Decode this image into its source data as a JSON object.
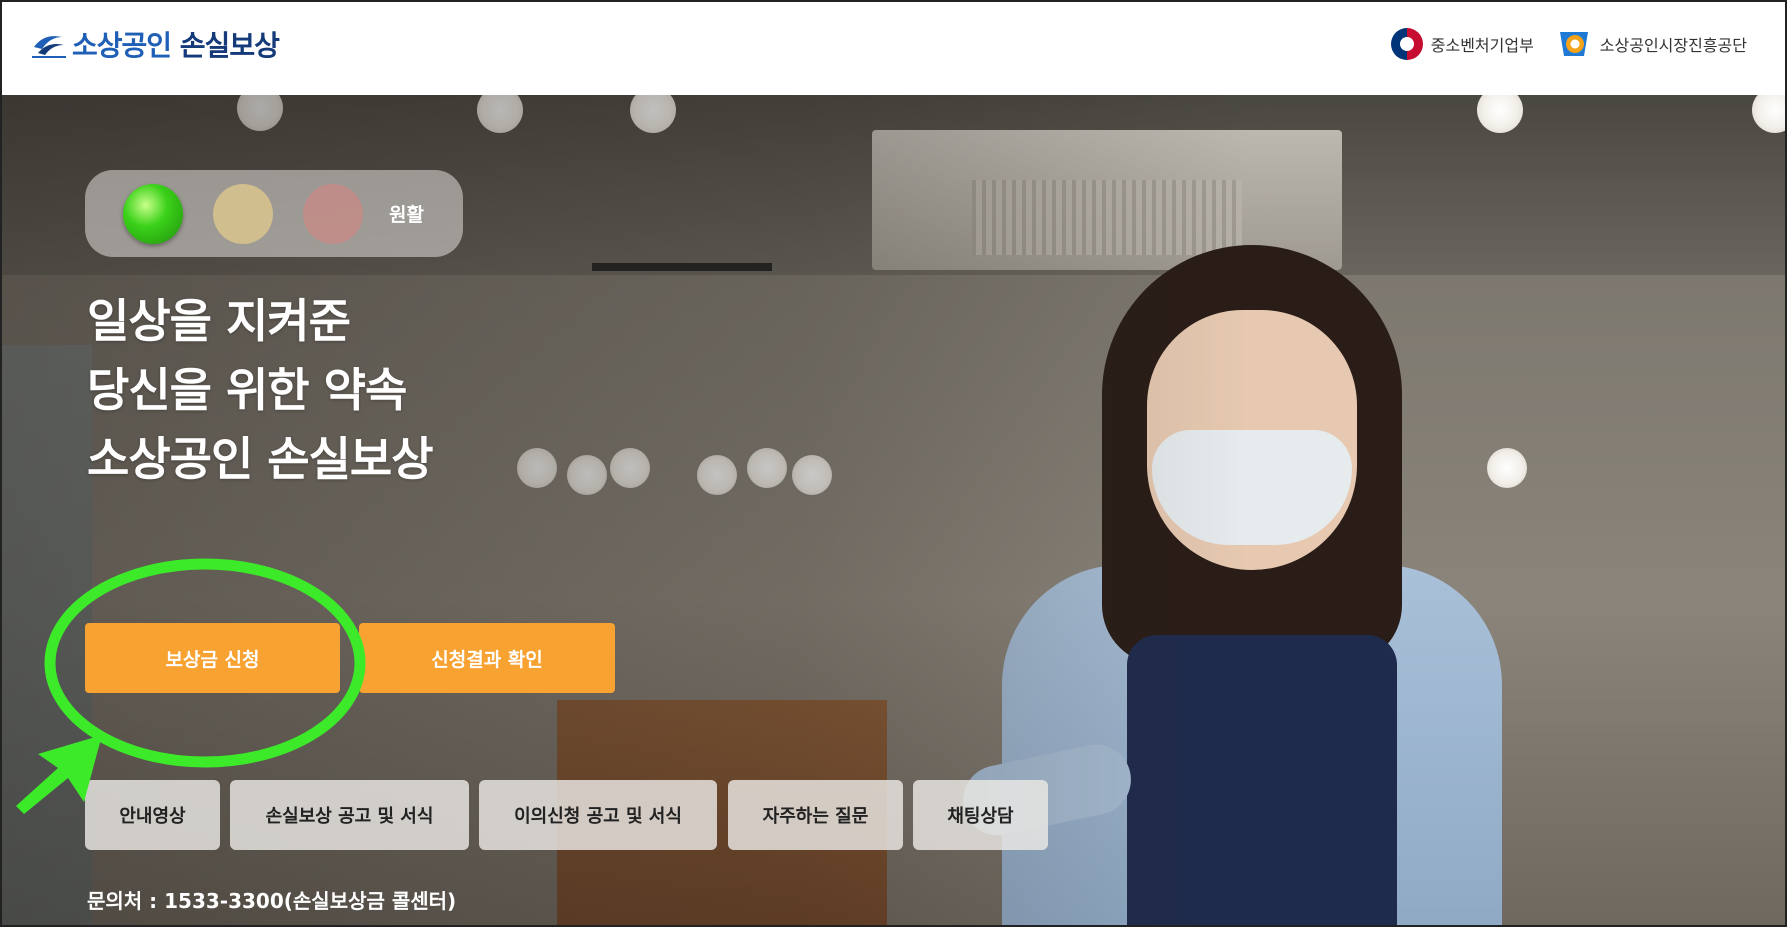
{
  "header": {
    "logo_text_1": "소상공인",
    "logo_text_2": "손실보상",
    "partners": [
      {
        "name": "중소벤처기업부",
        "icon": "korea-government-emblem-icon"
      },
      {
        "name": "소상공인시장진흥공단",
        "icon": "semas-emblem-icon"
      }
    ]
  },
  "status": {
    "label": "원활",
    "lights": [
      "green",
      "yellow",
      "red"
    ],
    "active": "green"
  },
  "headline": {
    "line1": "일상을 지켜준",
    "line2": "당신을 위한 약속",
    "line3": "소상공인 손실보상"
  },
  "cta": {
    "apply_label": "보상금 신청",
    "result_label": "신청결과 확인"
  },
  "quick_links": [
    {
      "label": "안내영상"
    },
    {
      "label": "손실보상 공고 및 서식"
    },
    {
      "label": "이의신청 공고 및 서식"
    },
    {
      "label": "자주하는 질문"
    },
    {
      "label": "채팅상담"
    }
  ],
  "contact": "문의처 : 1533-3300(손실보상금 콜센터)",
  "colors": {
    "brand_blue": "#1f5fb5",
    "cta_orange": "#f8a232",
    "annotation_green": "#3dea2a"
  }
}
